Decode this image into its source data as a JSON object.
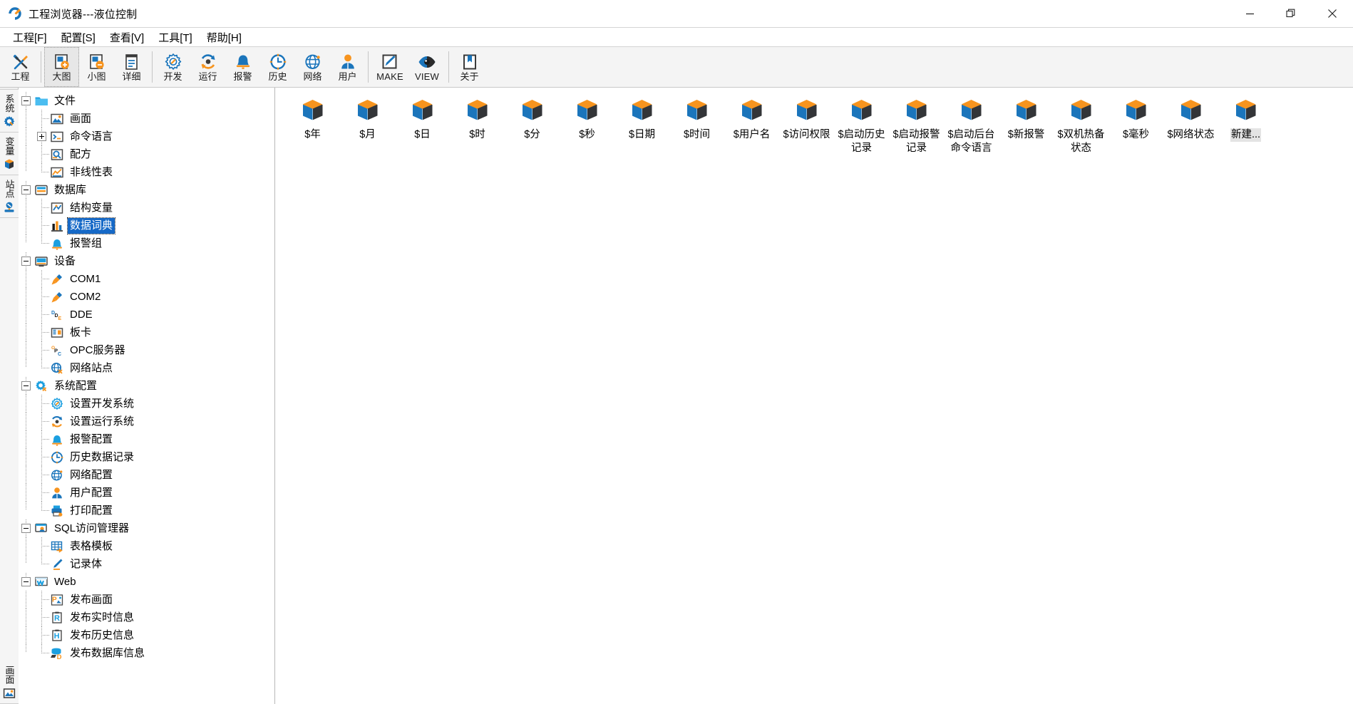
{
  "window": {
    "title": "工程浏览器---液位控制",
    "icon": "app-icon",
    "controls": {
      "minimize": "—",
      "maximize": "❐",
      "close": "✕"
    }
  },
  "menubar": [
    {
      "name": "menu-project",
      "label": "工程[F]"
    },
    {
      "name": "menu-config",
      "label": "配置[S]"
    },
    {
      "name": "menu-view",
      "label": "查看[V]"
    },
    {
      "name": "menu-tools",
      "label": "工具[T]"
    },
    {
      "name": "menu-help",
      "label": "帮助[H]"
    }
  ],
  "toolbar": {
    "groups": [
      {
        "items": [
          {
            "name": "toolbar-project",
            "label": "工程",
            "icon": "wrench-screwdriver-icon",
            "active": false
          }
        ]
      },
      {
        "items": [
          {
            "name": "toolbar-large-icons",
            "label": "大图",
            "icon": "large-icons-icon",
            "active": true
          },
          {
            "name": "toolbar-small-icons",
            "label": "小图",
            "icon": "small-icons-icon",
            "active": false
          },
          {
            "name": "toolbar-details",
            "label": "详细",
            "icon": "details-list-icon",
            "active": false
          }
        ]
      },
      {
        "items": [
          {
            "name": "toolbar-develop",
            "label": "开发",
            "icon": "develop-gear-icon",
            "active": false
          },
          {
            "name": "toolbar-run",
            "label": "运行",
            "icon": "run-refresh-icon",
            "active": false
          },
          {
            "name": "toolbar-alarm",
            "label": "报警",
            "icon": "alarm-bell-icon",
            "active": false
          },
          {
            "name": "toolbar-history",
            "label": "历史",
            "icon": "history-clock-icon",
            "active": false
          },
          {
            "name": "toolbar-network",
            "label": "网络",
            "icon": "network-globe-icon",
            "active": false
          },
          {
            "name": "toolbar-user",
            "label": "用户",
            "icon": "user-person-icon",
            "active": false
          }
        ]
      },
      {
        "items": [
          {
            "name": "toolbar-make",
            "label": "MAKE",
            "icon": "make-pencil-icon",
            "active": false
          },
          {
            "name": "toolbar-view",
            "label": "VIEW",
            "icon": "view-eye-icon",
            "active": false
          }
        ]
      },
      {
        "items": [
          {
            "name": "toolbar-about",
            "label": "关于",
            "icon": "about-book-icon",
            "active": false
          }
        ]
      }
    ]
  },
  "rail": [
    {
      "name": "rail-tab-system",
      "label": "系统",
      "icon": "gear-search-icon"
    },
    {
      "name": "rail-tab-variable",
      "label": "变量",
      "icon": "cube-icon"
    },
    {
      "name": "rail-tab-site",
      "label": "站点",
      "icon": "site-node-icon"
    },
    {
      "name": "rail-tab-screen",
      "label": "画面",
      "icon": "picture-icon"
    }
  ],
  "tree": [
    {
      "name": "tree-node-file",
      "label": "文件",
      "level": 0,
      "icon": "folder-icon",
      "expander": "minus",
      "selected": false
    },
    {
      "name": "tree-node-picture",
      "label": "画面",
      "level": 1,
      "icon": "picture-icon",
      "expander": "none",
      "selected": false
    },
    {
      "name": "tree-node-command-language",
      "label": "命令语言",
      "level": 1,
      "icon": "command-script-icon",
      "expander": "plus",
      "selected": false
    },
    {
      "name": "tree-node-recipe",
      "label": "配方",
      "level": 1,
      "icon": "recipe-icon",
      "expander": "none",
      "selected": false
    },
    {
      "name": "tree-node-nonlinear-table",
      "label": "非线性表",
      "level": 1,
      "icon": "chart-table-icon",
      "expander": "none",
      "selected": false
    },
    {
      "name": "tree-node-database",
      "label": "数据库",
      "level": 0,
      "icon": "database-icon",
      "expander": "minus",
      "selected": false
    },
    {
      "name": "tree-node-struct-variable",
      "label": "结构变量",
      "level": 1,
      "icon": "struct-var-icon",
      "expander": "none",
      "selected": false
    },
    {
      "name": "tree-node-data-dictionary",
      "label": "数据词典",
      "level": 1,
      "icon": "data-dictionary-icon",
      "expander": "none",
      "selected": true
    },
    {
      "name": "tree-node-alarm-group",
      "label": "报警组",
      "level": 1,
      "icon": "alarm-bell-icon",
      "expander": "none",
      "selected": false
    },
    {
      "name": "tree-node-device",
      "label": "设备",
      "level": 0,
      "icon": "monitor-icon",
      "expander": "minus",
      "selected": false
    },
    {
      "name": "tree-node-com1",
      "label": "COM1",
      "level": 1,
      "icon": "plug-icon",
      "expander": "none",
      "selected": false
    },
    {
      "name": "tree-node-com2",
      "label": "COM2",
      "level": 1,
      "icon": "plug-icon",
      "expander": "none",
      "selected": false
    },
    {
      "name": "tree-node-dde",
      "label": "DDE",
      "level": 1,
      "icon": "dde-icon",
      "expander": "none",
      "selected": false
    },
    {
      "name": "tree-node-board-card",
      "label": "板卡",
      "level": 1,
      "icon": "board-card-icon",
      "expander": "none",
      "selected": false
    },
    {
      "name": "tree-node-opc-server",
      "label": "OPC服务器",
      "level": 1,
      "icon": "opc-icon",
      "expander": "none",
      "selected": false
    },
    {
      "name": "tree-node-network-site",
      "label": "网络站点",
      "level": 1,
      "icon": "network-site-icon",
      "expander": "none",
      "selected": false
    },
    {
      "name": "tree-node-system-config",
      "label": "系统配置",
      "level": 0,
      "icon": "gear-config-icon",
      "expander": "minus",
      "selected": false
    },
    {
      "name": "tree-node-set-dev-system",
      "label": "设置开发系统",
      "level": 1,
      "icon": "develop-gear-icon",
      "expander": "none",
      "selected": false
    },
    {
      "name": "tree-node-set-run-system",
      "label": "设置运行系统",
      "level": 1,
      "icon": "run-refresh-icon",
      "expander": "none",
      "selected": false
    },
    {
      "name": "tree-node-alarm-config",
      "label": "报警配置",
      "level": 1,
      "icon": "alarm-bell-icon",
      "expander": "none",
      "selected": false
    },
    {
      "name": "tree-node-history-record",
      "label": "历史数据记录",
      "level": 1,
      "icon": "history-clock-icon",
      "expander": "none",
      "selected": false
    },
    {
      "name": "tree-node-network-config",
      "label": "网络配置",
      "level": 1,
      "icon": "network-globe-icon",
      "expander": "none",
      "selected": false
    },
    {
      "name": "tree-node-user-config",
      "label": "用户配置",
      "level": 1,
      "icon": "user-person-icon",
      "expander": "none",
      "selected": false
    },
    {
      "name": "tree-node-print-config",
      "label": "打印配置",
      "level": 1,
      "icon": "printer-icon",
      "expander": "none",
      "selected": false
    },
    {
      "name": "tree-node-sql-manager",
      "label": "SQL访问管理器",
      "level": 0,
      "icon": "sql-manager-icon",
      "expander": "minus",
      "selected": false
    },
    {
      "name": "tree-node-table-template",
      "label": "表格模板",
      "level": 1,
      "icon": "table-template-icon",
      "expander": "none",
      "selected": false
    },
    {
      "name": "tree-node-record-body",
      "label": "记录体",
      "level": 1,
      "icon": "record-pen-icon",
      "expander": "none",
      "selected": false
    },
    {
      "name": "tree-node-web",
      "label": "Web",
      "level": 0,
      "icon": "web-icon",
      "expander": "minus",
      "selected": false
    },
    {
      "name": "tree-node-publish-picture",
      "label": "发布画面",
      "level": 1,
      "icon": "publish-picture-icon",
      "expander": "none",
      "selected": false
    },
    {
      "name": "tree-node-publish-realtime",
      "label": "发布实时信息",
      "level": 1,
      "icon": "publish-realtime-icon",
      "expander": "none",
      "selected": false
    },
    {
      "name": "tree-node-publish-history",
      "label": "发布历史信息",
      "level": 1,
      "icon": "publish-history-icon",
      "expander": "none",
      "selected": false
    },
    {
      "name": "tree-node-publish-database",
      "label": "发布数据库信息",
      "level": 1,
      "icon": "publish-database-icon",
      "expander": "none",
      "selected": false
    }
  ],
  "content": {
    "icon_name": "variable-cube-icon",
    "items": [
      {
        "name": "grid-item-year",
        "label": "$年",
        "selected": false
      },
      {
        "name": "grid-item-month",
        "label": "$月",
        "selected": false
      },
      {
        "name": "grid-item-day",
        "label": "$日",
        "selected": false
      },
      {
        "name": "grid-item-hour",
        "label": "$时",
        "selected": false
      },
      {
        "name": "grid-item-minute",
        "label": "$分",
        "selected": false
      },
      {
        "name": "grid-item-second",
        "label": "$秒",
        "selected": false
      },
      {
        "name": "grid-item-date",
        "label": "$日期",
        "selected": false
      },
      {
        "name": "grid-item-time",
        "label": "$时间",
        "selected": false
      },
      {
        "name": "grid-item-username",
        "label": "$用户名",
        "selected": false
      },
      {
        "name": "grid-item-access-right",
        "label": "$访问权限",
        "selected": false
      },
      {
        "name": "grid-item-start-history",
        "label": "$启动历史记录",
        "selected": false
      },
      {
        "name": "grid-item-start-alarm-log",
        "label": "$启动报警记录",
        "selected": false
      },
      {
        "name": "grid-item-start-bg-cmd",
        "label": "$启动后台命令语言",
        "selected": false
      },
      {
        "name": "grid-item-new-alarm",
        "label": "$新报警",
        "selected": false
      },
      {
        "name": "grid-item-redundancy",
        "label": "$双机热备状态",
        "selected": false
      },
      {
        "name": "grid-item-millisecond",
        "label": "$毫秒",
        "selected": false
      },
      {
        "name": "grid-item-network-status",
        "label": "$网络状态",
        "selected": false
      },
      {
        "name": "grid-item-new",
        "label": "新建...",
        "selected": true
      }
    ]
  },
  "colors": {
    "accent_orange": "#f7941e",
    "accent_blue": "#1b75bb",
    "dark": "#333538",
    "selection_blue": "#1669c7",
    "toolbar_bg": "#f4f4f4"
  }
}
